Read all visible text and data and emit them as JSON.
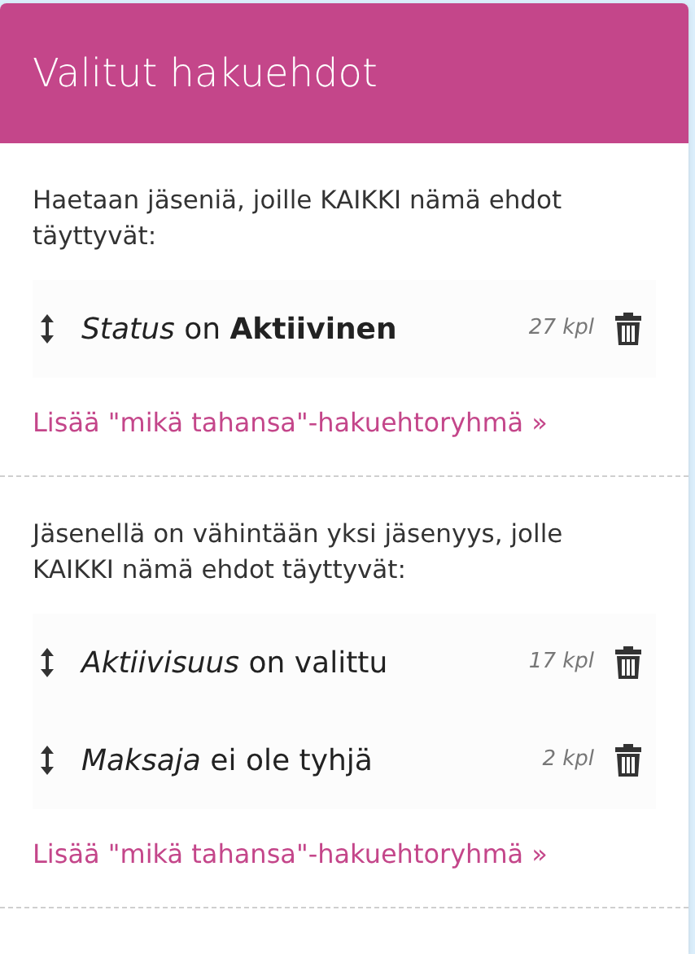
{
  "panel": {
    "title": "Valitut hakuehdot"
  },
  "groups": [
    {
      "description": "Haetaan jäseniä, joille KAIKKI nämä ehdot täyttyvät:",
      "conditions": [
        {
          "text": "*Status* on **Aktiivinen**",
          "count": "27 kpl"
        }
      ],
      "add_link": "Lisää \"mikä tahansa\"-hakuehtoryhmä »"
    },
    {
      "description": "Jäsenellä on vähintään yksi jäsenyys, jolle KAIKKI nämä ehdot täyttyvät:",
      "conditions": [
        {
          "text": "*Aktiivisuus* on valittu",
          "count": "17 kpl"
        },
        {
          "text": "*Maksaja* ei ole tyhjä",
          "count": "2 kpl"
        }
      ],
      "add_link": "Lisää \"mikä tahansa\"-hakuehtoryhmä »"
    }
  ]
}
